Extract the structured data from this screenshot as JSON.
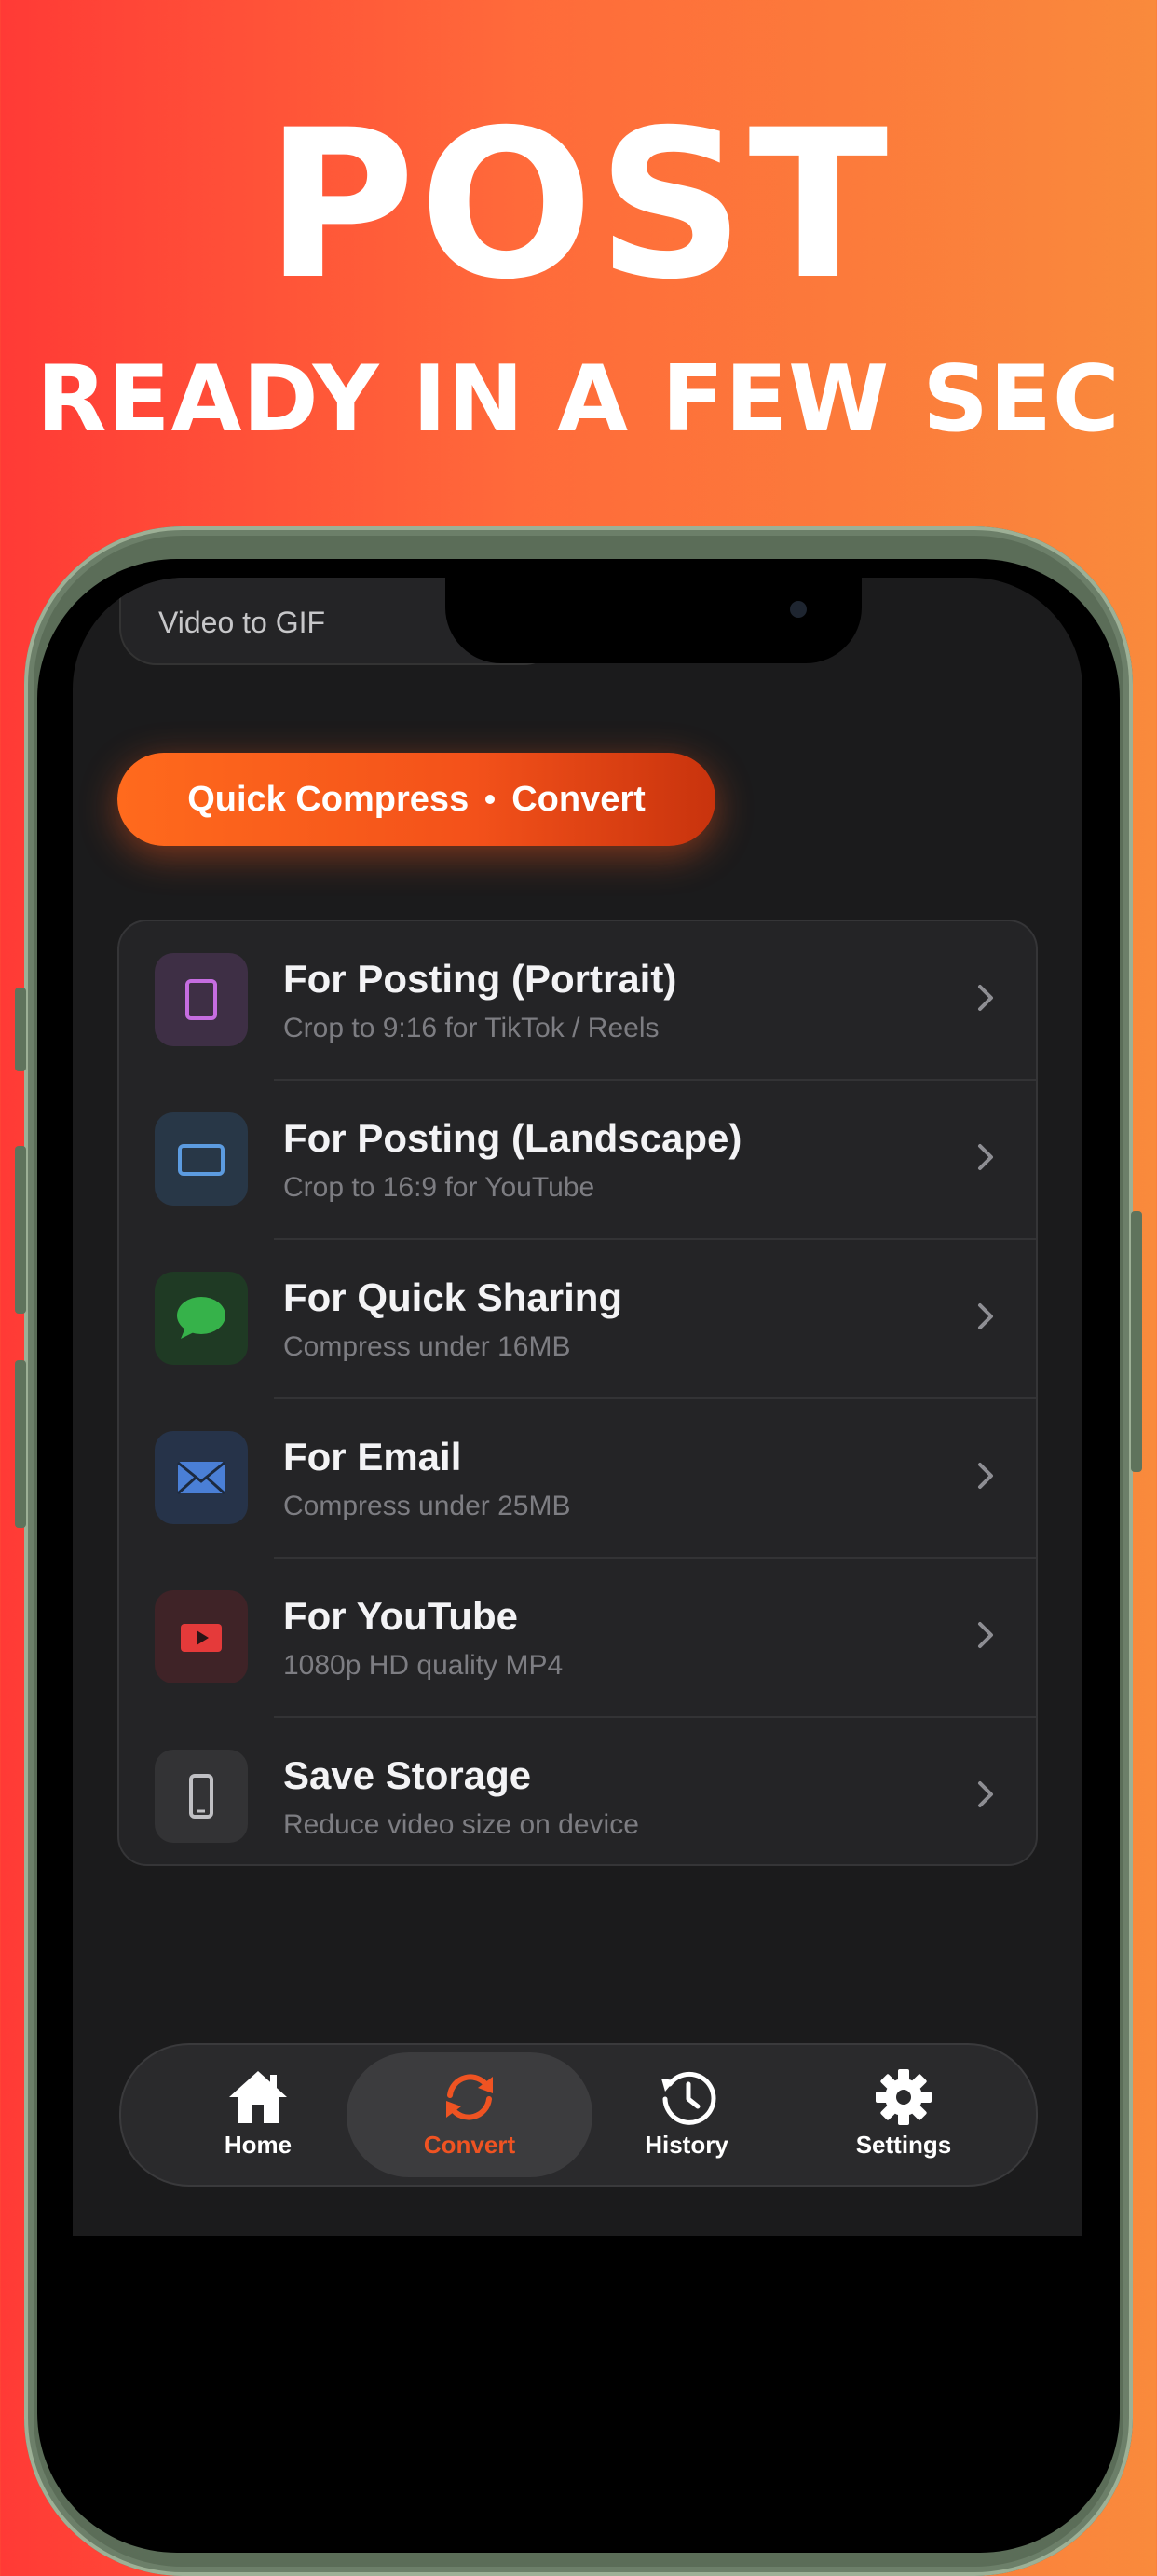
{
  "headline": {
    "title": "POST",
    "subtitle": "READY IN A FEW SEC"
  },
  "top_chip": {
    "label": "Video to GIF"
  },
  "quick_pill": {
    "left": "Quick Compress",
    "right": "Convert"
  },
  "presets": [
    {
      "title": "For Posting (Portrait)",
      "subtitle": "Crop to 9:16 for TikTok / Reels",
      "icon": "portrait-icon"
    },
    {
      "title": "For Posting (Landscape)",
      "subtitle": "Crop to 16:9 for YouTube",
      "icon": "landscape-icon"
    },
    {
      "title": "For Quick Sharing",
      "subtitle": "Compress under 16MB",
      "icon": "message-bubble-icon"
    },
    {
      "title": "For Email",
      "subtitle": "Compress under 25MB",
      "icon": "envelope-icon"
    },
    {
      "title": "For YouTube",
      "subtitle": "1080p HD quality MP4",
      "icon": "play-icon"
    },
    {
      "title": "Save Storage",
      "subtitle": "Reduce video size on device",
      "icon": "phone-icon"
    }
  ],
  "tabbar": {
    "home": "Home",
    "convert": "Convert",
    "history": "History",
    "settings": "Settings",
    "active": "Convert"
  },
  "colors": {
    "accent": "#EF5322",
    "background": "#1B1B1C",
    "card": "#242426"
  }
}
